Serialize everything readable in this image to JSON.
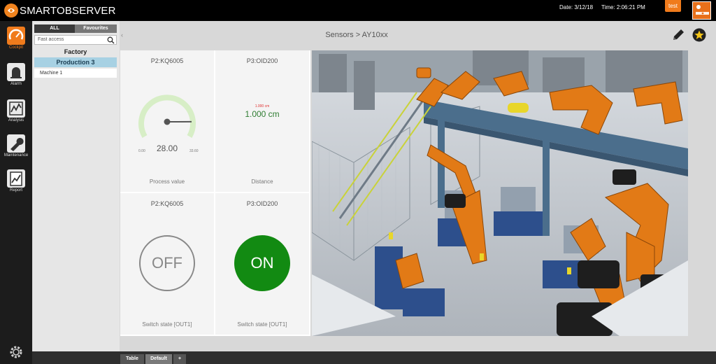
{
  "app": {
    "title": "SMARTOBSERVER",
    "date": "Date: 3/12/18",
    "time": "Time: 2:06:21 PM",
    "user": "test"
  },
  "nav": [
    {
      "label": "Cockpit",
      "active": true
    },
    {
      "label": "Alarm",
      "active": false
    },
    {
      "label": "Analysis",
      "active": false
    },
    {
      "label": "Maintenance",
      "active": false
    },
    {
      "label": "Report",
      "active": false
    }
  ],
  "tree": {
    "tabs": {
      "all": "ALL",
      "favourites": "Favourites"
    },
    "search_placeholder": "Fast access",
    "factory": "Factory",
    "production": "Production 3",
    "machine": "Machine 1"
  },
  "header": {
    "breadcrumb": "Sensors > AY10xx"
  },
  "tiles": {
    "gauge": {
      "title": "P2:KQ6005",
      "value": "28.00",
      "min": "0.00",
      "max": "33.60",
      "fraction": 0.833,
      "footer": "Process value"
    },
    "distance": {
      "title": "P3:OID200",
      "small": "1.000 cm",
      "value": "1.000 cm",
      "footer": "Distance"
    },
    "switch_off": {
      "title": "P2:KQ6005",
      "state": "OFF",
      "footer": "Switch state [OUT1]"
    },
    "switch_on": {
      "title": "P3:OID200",
      "state": "ON",
      "footer": "Switch state [OUT1]"
    }
  },
  "bottom_tabs": {
    "table": "Table",
    "default": "Default",
    "add": "+"
  },
  "colors": {
    "accent": "#f07b1c",
    "on": "#128a12",
    "selection": "#a7d1e3"
  }
}
